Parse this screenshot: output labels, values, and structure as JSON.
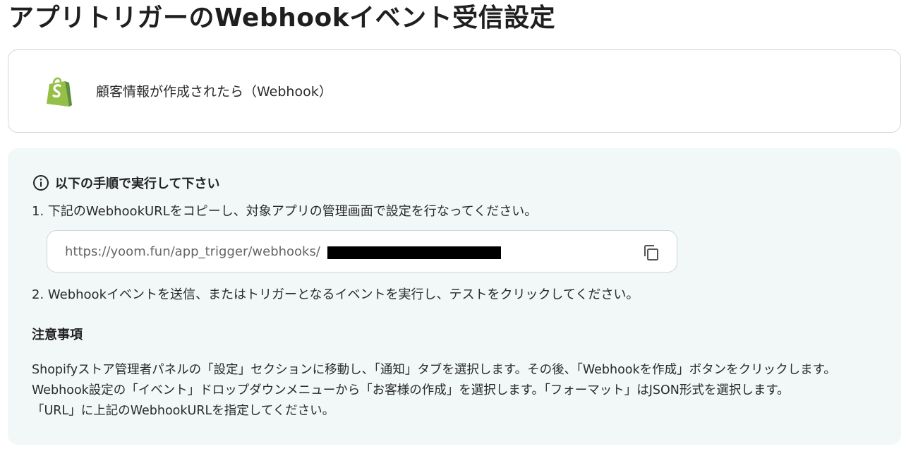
{
  "page": {
    "title": "アプリトリガーのWebhookイベント受信設定"
  },
  "trigger": {
    "app_icon": "shopify-bag-icon",
    "label": "顧客情報が作成されたら（Webhook）"
  },
  "instructions": {
    "title": "以下の手順で実行して下さい",
    "step1": "1. 下記のWebhookURLをコピーし、対象アプリの管理画面で設定を行なってください。",
    "webhook_url": "https://yoom.fun/app_trigger/webhooks/",
    "step2": "2. Webhookイベントを送信、またはトリガーとなるイベントを実行し、テストをクリックしてください。"
  },
  "notes": {
    "title": "注意事項",
    "lines": [
      "Shopifyストア管理者パネルの「設定」セクションに移動し、「通知」タブを選択します。その後、「Webhookを作成」ボタンをクリックします。",
      "Webhook設定の「イベント」ドロップダウンメニューから「お客様の作成」を選択します。「フォーマット」はJSON形式を選択します。",
      "「URL」に上記のWebhookURLを指定してください。"
    ]
  },
  "colors": {
    "panel_bg": "#f1f8f7",
    "shopify_green": "#95bf47",
    "shopify_dark": "#5e8e3e"
  }
}
